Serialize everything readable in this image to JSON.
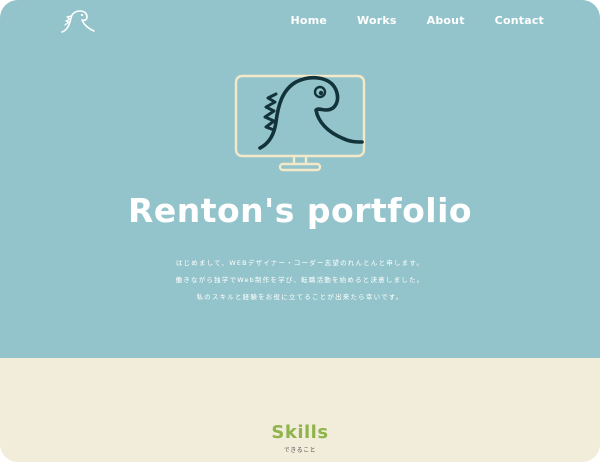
{
  "header": {
    "logo_icon": "dinosaur-logo-icon",
    "nav": [
      {
        "label": "Home"
      },
      {
        "label": "Works"
      },
      {
        "label": "About"
      },
      {
        "label": "Contact"
      }
    ]
  },
  "hero": {
    "illustration_icon": "dinosaur-monitor-icon",
    "title": "Renton's portfolio",
    "intro_lines": [
      "はじめまして、WEBデザイナー・コーダー志望のれんとんと申します。",
      "働きながら独学でWeb制作を学び、転職活動を始めると決意しました。",
      "私のスキルと経験をお役に立てることが出来たら幸いです。"
    ]
  },
  "skills": {
    "title": "Skills",
    "subtitle": "できること"
  },
  "colors": {
    "hero_bg": "#94c4cb",
    "section_bg": "#f2ecdb",
    "accent_green": "#8fb44c",
    "line_dark": "#13333a",
    "line_cream": "#f3e8c8"
  }
}
